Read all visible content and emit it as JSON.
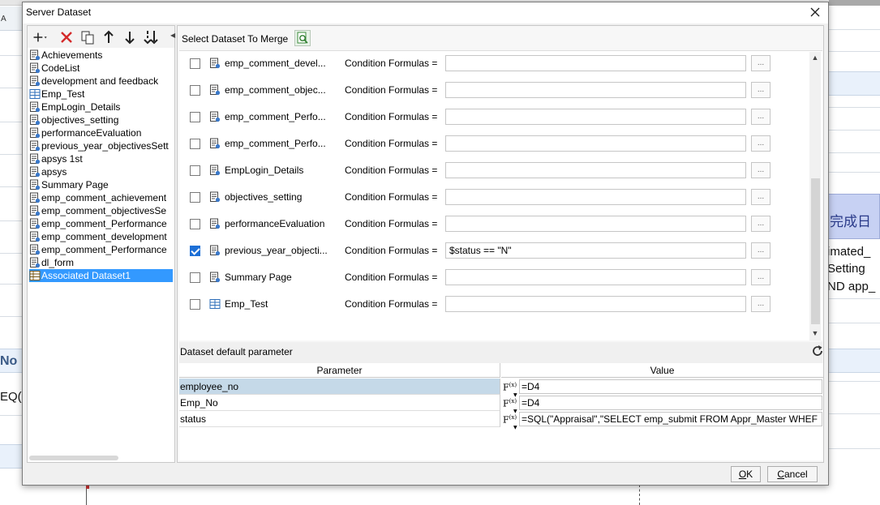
{
  "window": {
    "title": "Server Dataset"
  },
  "background": {
    "column_letter": "A",
    "fragments": [
      "完成日",
      "imated_",
      "Setting",
      "ND app_",
      "No",
      "EQ("
    ]
  },
  "toolbar_left": {
    "add": "add-icon",
    "delete": "delete-icon",
    "copy": "copy-icon",
    "up": "move-up-icon",
    "down": "move-down-icon",
    "bottom": "move-bottom-icon"
  },
  "tree": {
    "items": [
      "Achievements",
      "CodeList",
      "development and feedback",
      "Emp_Test",
      "EmpLogin_Details",
      "objectives_setting",
      "performanceEvaluation",
      "previous_year_objectivesSett",
      "apsys 1st",
      "apsys",
      "Summary Page",
      "emp_comment_achievement",
      "emp_comment_objectivesSe",
      "emp_comment_Performance",
      "emp_comment_development",
      "emp_comment_Performance",
      "dl_form",
      "Associated Dataset1"
    ],
    "selected_index": 17
  },
  "merge": {
    "label": "Select Dataset To Merge"
  },
  "datasets": {
    "condition_label": "Condition Formulas =",
    "dots_label": "...",
    "rows": [
      {
        "name": "emp_comment_devel...",
        "checked": false,
        "formula": ""
      },
      {
        "name": "emp_comment_objec...",
        "checked": false,
        "formula": ""
      },
      {
        "name": "emp_comment_Perfo...",
        "checked": false,
        "formula": ""
      },
      {
        "name": "emp_comment_Perfo...",
        "checked": false,
        "formula": ""
      },
      {
        "name": "EmpLogin_Details",
        "checked": false,
        "formula": ""
      },
      {
        "name": "objectives_setting",
        "checked": false,
        "formula": ""
      },
      {
        "name": "performanceEvaluation",
        "checked": false,
        "formula": ""
      },
      {
        "name": "previous_year_objecti...",
        "checked": true,
        "formula": "$status == \"N\""
      },
      {
        "name": "Summary Page",
        "checked": false,
        "formula": ""
      },
      {
        "name": "Emp_Test",
        "checked": false,
        "formula": ""
      }
    ]
  },
  "params": {
    "title": "Dataset default parameter",
    "col_parameter": "Parameter",
    "col_value": "Value",
    "rows": [
      {
        "name": "employee_no",
        "value": "=D4"
      },
      {
        "name": "Emp_No",
        "value": "=D4"
      },
      {
        "name": "status",
        "value": "=SQL(\"Appraisal\",\"SELECT emp_submit FROM Appr_Master WHEF"
      }
    ],
    "fx_label": "F",
    "fx_sub": "(x)"
  },
  "buttons": {
    "ok_pre": "",
    "ok_ul": "O",
    "ok_post": "K",
    "cancel_ul": "C",
    "cancel_post": "ancel"
  }
}
